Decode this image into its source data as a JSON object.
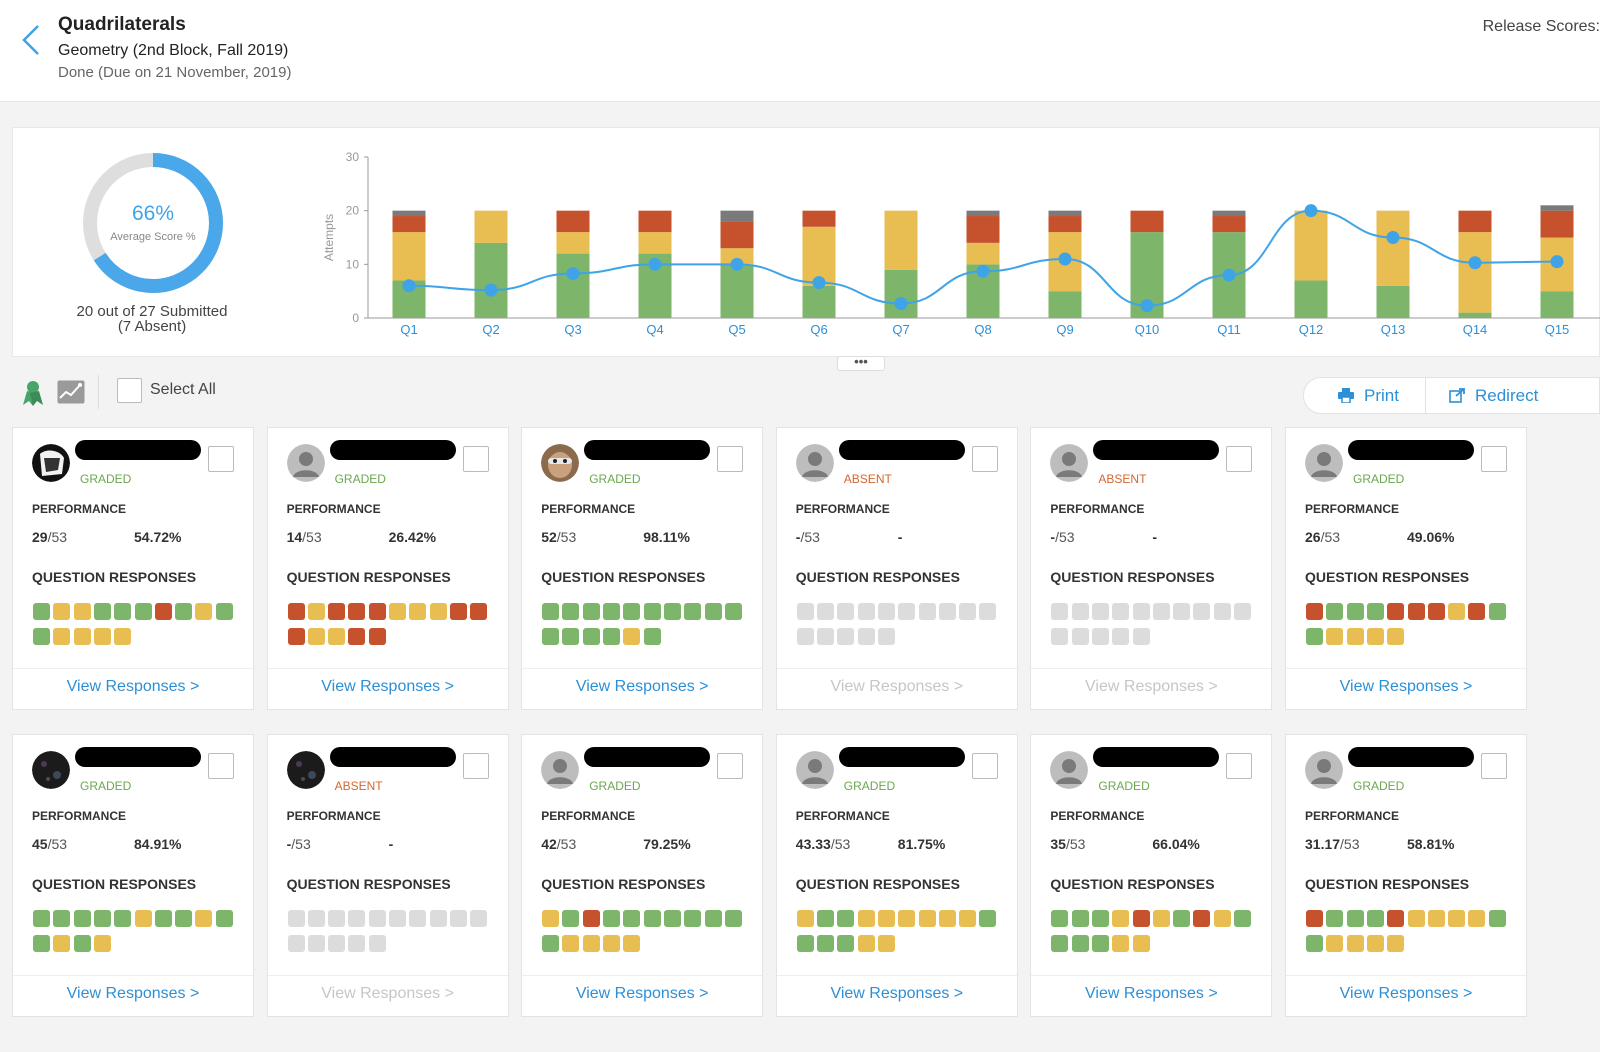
{
  "header": {
    "title": "Quadrilaterals",
    "subtitle": "Geometry (2nd Block, Fall 2019)",
    "due": "Done (Due on 21 November, 2019)",
    "release_scores": "Release Scores:"
  },
  "summary": {
    "average_percent": "66%",
    "average_label": "Average Score %",
    "average_value": 0.66,
    "submitted_line1": "20 out of 27 Submitted",
    "submitted_line2": "(7 Absent)"
  },
  "chart_data": {
    "type": "bar",
    "stacked": true,
    "ylabel": "Attempts",
    "ylim": [
      0,
      30
    ],
    "yticks": [
      "0",
      "10",
      "20",
      "30"
    ],
    "categories": [
      "Q1",
      "Q2",
      "Q3",
      "Q4",
      "Q5",
      "Q6",
      "Q7",
      "Q8",
      "Q9",
      "Q10",
      "Q11",
      "Q12",
      "Q13",
      "Q14",
      "Q15"
    ],
    "series": [
      {
        "color": "#7db56a",
        "values": [
          7,
          14,
          12,
          12,
          10,
          6,
          9,
          10,
          5,
          16,
          16,
          7,
          6,
          1,
          5
        ]
      },
      {
        "color": "#e8bd52",
        "values": [
          9,
          6,
          4,
          4,
          3,
          11,
          11,
          4,
          11,
          0,
          0,
          13,
          14,
          15,
          10
        ]
      },
      {
        "color": "#c5522d",
        "values": [
          3,
          0,
          4,
          4,
          5,
          3,
          0,
          5,
          3,
          4,
          3,
          0,
          0,
          4,
          5
        ]
      },
      {
        "color": "#7a7a7a",
        "values": [
          1,
          0,
          0,
          0,
          2,
          0,
          0,
          1,
          1,
          0,
          1,
          0,
          0,
          0,
          1
        ]
      }
    ],
    "line": {
      "color": "#3fa3e8",
      "values": [
        6,
        5.2,
        8.3,
        10,
        10,
        6.6,
        2.7,
        8.7,
        11,
        2.3,
        8,
        20,
        15,
        10.3,
        10.5
      ]
    }
  },
  "toolbar": {
    "select_all": "Select All",
    "print": "Print",
    "redirect": "Redirect",
    "expander": "•••"
  },
  "labels": {
    "performance": "PERFORMANCE",
    "question_responses": "QUESTION RESPONSES",
    "view_responses": "View Responses >",
    "total": "/53"
  },
  "colors": {
    "green": "#7db56a",
    "yellow": "#e8bd52",
    "red": "#c5522d",
    "gray": "#8c8c8c",
    "empty": "#dcdcdc",
    "graded": "#6aa84f",
    "absent": "#d6662e",
    "link": "#2d8fd6",
    "link_disabled": "#c6c6c6"
  },
  "students": [
    {
      "status": "GRADED",
      "score": "29",
      "percent": "54.72%",
      "avatar": "photo-bw",
      "responses": "gyygggrgyg gyyyy"
    },
    {
      "status": "GRADED",
      "score": "14",
      "percent": "26.42%",
      "avatar": "default",
      "responses": "ryrrryyyrr ryyrr"
    },
    {
      "status": "GRADED",
      "score": "52",
      "percent": "98.11%",
      "avatar": "photo-face",
      "responses": "gggggggggg ggggyg"
    },
    {
      "status": "ABSENT",
      "score": "-",
      "percent": "-",
      "avatar": "default",
      "responses": "eeeeeeeeee eeeee"
    },
    {
      "status": "ABSENT",
      "score": "-",
      "percent": "-",
      "avatar": "default",
      "responses": "eeeeeeeeee eeeee"
    },
    {
      "status": "GRADED",
      "score": "26",
      "percent": "49.06%",
      "avatar": "default",
      "responses": "rgggrrryrg gyyyy"
    },
    {
      "status": "GRADED",
      "score": "45",
      "percent": "84.91%",
      "avatar": "photo-dark",
      "responses": "gggggyggyg gygy"
    },
    {
      "status": "ABSENT",
      "score": "-",
      "percent": "-",
      "avatar": "photo-dark",
      "responses": "eeeeeeeeee eeeee"
    },
    {
      "status": "GRADED",
      "score": "42",
      "percent": "79.25%",
      "avatar": "default",
      "responses": "ygrggggggg gyyyy"
    },
    {
      "status": "GRADED",
      "score": "43.33",
      "percent": "81.75%",
      "avatar": "default",
      "responses": "yggyyyyyyg gggyy"
    },
    {
      "status": "GRADED",
      "score": "35",
      "percent": "66.04%",
      "avatar": "default",
      "responses": "gggyrygryg gggyy"
    },
    {
      "status": "GRADED",
      "score": "31.17",
      "percent": "58.81%",
      "avatar": "default",
      "responses": "rgggryyyyg gyyyy"
    }
  ]
}
